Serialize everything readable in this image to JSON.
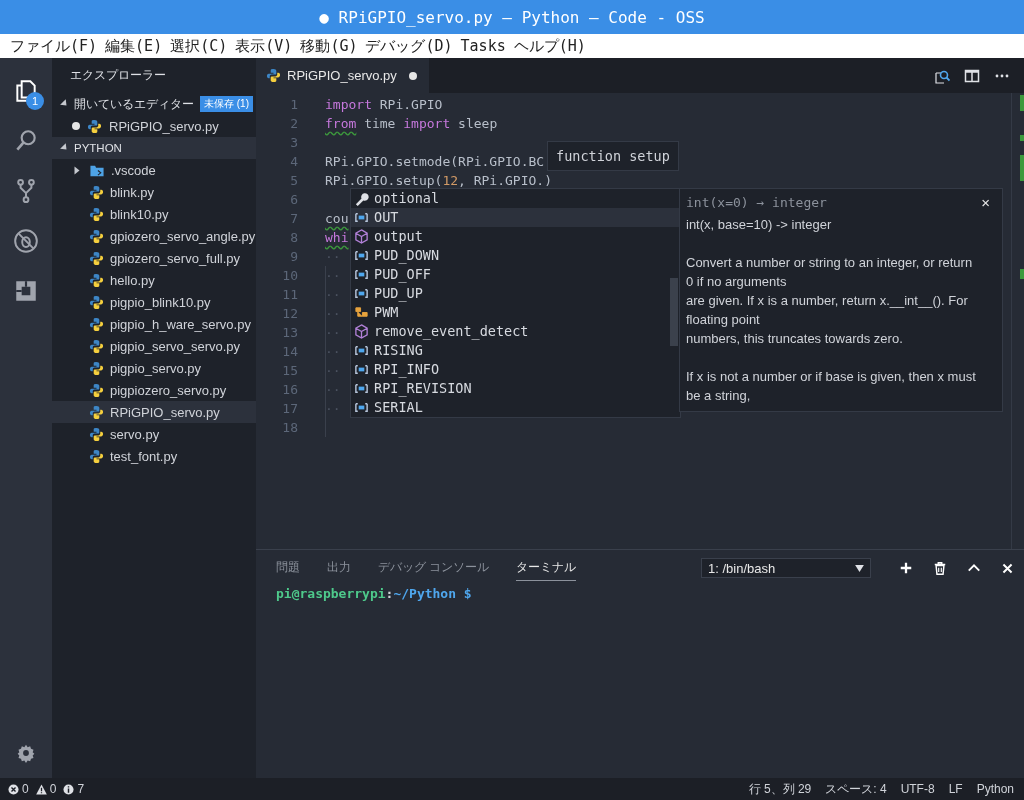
{
  "window": {
    "title": "● RPiGPIO_servo.py — Python — Code - OSS"
  },
  "menu": [
    "ファイル(F)",
    "編集(E)",
    "選択(C)",
    "表示(V)",
    "移動(G)",
    "デバッグ(D)",
    "Tasks",
    "ヘルプ(H)"
  ],
  "activity_bar": [
    {
      "kind": "files",
      "selected": true,
      "badge": "1"
    },
    {
      "kind": "search",
      "selected": false
    },
    {
      "kind": "git",
      "selected": false
    },
    {
      "kind": "debug",
      "selected": false
    },
    {
      "kind": "extensions",
      "selected": false
    }
  ],
  "sidebar": {
    "title": "エクスプローラー",
    "open_editors": {
      "label": "開いているエディター",
      "badge": "未保存 (1)",
      "expanded": true,
      "items": [
        {
          "name": "RPiGPIO_servo.py",
          "dirty": true
        }
      ]
    },
    "folder": {
      "label": "PYTHON",
      "expanded": true,
      "items": [
        {
          "name": ".vscode",
          "kind": "folder",
          "expanded": false,
          "selected": false
        },
        {
          "name": "blink.py",
          "kind": "python",
          "selected": false
        },
        {
          "name": "blink10.py",
          "kind": "python",
          "selected": false
        },
        {
          "name": "gpiozero_servo_angle.py",
          "kind": "python",
          "selected": false
        },
        {
          "name": "gpiozero_servo_full.py",
          "kind": "python",
          "selected": false
        },
        {
          "name": "hello.py",
          "kind": "python",
          "selected": false
        },
        {
          "name": "pigpio_blink10.py",
          "kind": "python",
          "selected": false
        },
        {
          "name": "pigpio_h_ware_servo.py",
          "kind": "python",
          "selected": false
        },
        {
          "name": "pigpio_servo_servo.py",
          "kind": "python",
          "selected": false
        },
        {
          "name": "pigpio_servo.py",
          "kind": "python",
          "selected": false
        },
        {
          "name": "pigpiozero_servo.py",
          "kind": "python",
          "selected": false
        },
        {
          "name": "RPiGPIO_servo.py",
          "kind": "python",
          "selected": true
        },
        {
          "name": "servo.py",
          "kind": "python",
          "selected": false
        },
        {
          "name": "test_font.py",
          "kind": "python",
          "selected": false
        }
      ]
    }
  },
  "editor": {
    "tabs": [
      {
        "label": "RPiGPIO_servo.py",
        "dirty": true,
        "selected": true
      }
    ],
    "lines": [
      {
        "number": "1",
        "tokens": [
          {
            "kind": "keyword",
            "text": "import"
          },
          {
            "kind": "plain",
            "text": " RPi.GPIO"
          }
        ]
      },
      {
        "number": "2",
        "tokens": [
          {
            "kind": "keyword",
            "text": "from",
            "squiggle": true
          },
          {
            "kind": "plain",
            "text": " time "
          },
          {
            "kind": "keyword",
            "text": "import"
          },
          {
            "kind": "plain",
            "text": " sleep"
          }
        ]
      },
      {
        "number": "3"
      },
      {
        "number": "4",
        "tokens": [
          {
            "kind": "plain",
            "text": "RPi.GPIO.setmode(RPi.GPIO.BC"
          }
        ]
      },
      {
        "number": "5",
        "tokens": [
          {
            "kind": "plain",
            "text": "RPi.GPIO.setup("
          },
          {
            "kind": "number",
            "text": "12"
          },
          {
            "kind": "plain",
            "text": ", RPi.GPIO."
          },
          {
            "kind": "plain",
            "text": ")"
          }
        ]
      },
      {
        "number": "6"
      },
      {
        "number": "7",
        "tokens": [
          {
            "kind": "plain",
            "text": "cou",
            "squiggle": true
          }
        ]
      },
      {
        "number": "8",
        "tokens": [
          {
            "kind": "keyword",
            "text": "whi",
            "squiggle": true
          }
        ]
      },
      {
        "number": "9",
        "tokens": [
          {
            "kind": "whitespace",
            "text": "··"
          }
        ]
      },
      {
        "number": "10",
        "tokens": [
          {
            "kind": "whitespace",
            "text": "··"
          }
        ]
      },
      {
        "number": "11",
        "tokens": [
          {
            "kind": "whitespace",
            "text": "··"
          }
        ]
      },
      {
        "number": "12",
        "tokens": [
          {
            "kind": "whitespace",
            "text": "··"
          }
        ]
      },
      {
        "number": "13",
        "tokens": [
          {
            "kind": "whitespace",
            "text": "··"
          }
        ]
      },
      {
        "number": "14",
        "tokens": [
          {
            "kind": "whitespace",
            "text": "··"
          }
        ]
      },
      {
        "number": "15",
        "tokens": [
          {
            "kind": "whitespace",
            "text": "··"
          }
        ]
      },
      {
        "number": "16",
        "tokens": [
          {
            "kind": "whitespace",
            "text": "··"
          }
        ]
      },
      {
        "number": "17",
        "tokens": [
          {
            "kind": "whitespace",
            "text": "··"
          }
        ]
      },
      {
        "number": "18"
      }
    ],
    "hover": "function setup",
    "suggestions": [
      {
        "label": "optional",
        "kind": "keyword",
        "selected": false
      },
      {
        "label": "OUT",
        "kind": "constant",
        "selected": true
      },
      {
        "label": "output",
        "kind": "module",
        "selected": false
      },
      {
        "label": "PUD_DOWN",
        "kind": "constant",
        "selected": false
      },
      {
        "label": "PUD_OFF",
        "kind": "constant",
        "selected": false
      },
      {
        "label": "PUD_UP",
        "kind": "constant",
        "selected": false
      },
      {
        "label": "PWM",
        "kind": "class",
        "selected": false
      },
      {
        "label": "remove_event_detect",
        "kind": "module",
        "selected": false
      },
      {
        "label": "RISING",
        "kind": "constant",
        "selected": false
      },
      {
        "label": "RPI_INFO",
        "kind": "constant",
        "selected": false
      },
      {
        "label": "RPI_REVISION",
        "kind": "constant",
        "selected": false
      },
      {
        "label": "SERIAL",
        "kind": "constant",
        "selected": false
      }
    ],
    "details": {
      "signature": "int(x=0) → integer",
      "close": "×",
      "paragraphs": [
        "int(x, base=10) -> integer",
        "Convert a number or string to an integer, or return\n0 if no arguments\nare given.  If x is a number, return x.__int__().  For\nfloating point\nnumbers, this truncates towards zero.",
        "If x is not a number or if base is given, then x must\nbe a string,"
      ]
    }
  },
  "panel": {
    "tabs": [
      {
        "label": "問題",
        "selected": false
      },
      {
        "label": "出力",
        "selected": false
      },
      {
        "label": "デバッグ コンソール",
        "selected": false
      },
      {
        "label": "ターミナル",
        "selected": true
      }
    ],
    "terminal_select": "1: /bin/bash",
    "prompt": {
      "user": "pi@raspberrypi",
      "separator": ":",
      "path": "~/Python $"
    }
  },
  "status_bar": {
    "errors": "0",
    "warnings": "0",
    "infos": "7",
    "right": [
      "行 5、列 29",
      "スペース: 4",
      "UTF-8",
      "LF",
      "Python"
    ]
  }
}
